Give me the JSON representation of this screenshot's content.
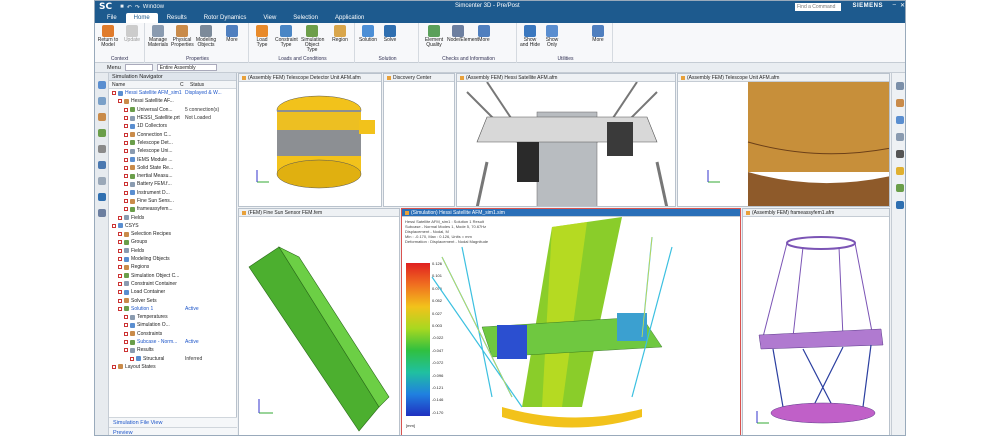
{
  "title": {
    "logo": "SC",
    "window_menu": "Window",
    "window_title": "Simcenter 3D - Pre/Post",
    "brand": "SIEMENS",
    "find_placeholder": "Find a Command"
  },
  "menus": [
    "File",
    "Home",
    "Results",
    "Rotor Dynamics",
    "View",
    "Selection",
    "Application"
  ],
  "ribbon": {
    "groups": [
      {
        "label": "Context",
        "buttons": [
          "Return to Model",
          "Update"
        ]
      },
      {
        "label": "Properties",
        "buttons": [
          "Manage Materials",
          "Physical Properties",
          "Modeling Objects",
          "More"
        ]
      },
      {
        "label": "Loads and Conditions",
        "buttons": [
          "Load Type",
          "Constraint Type",
          "Simulation Object Type",
          "Region"
        ]
      },
      {
        "label": "Solution",
        "buttons": [
          "Solution",
          "Solve"
        ]
      },
      {
        "label": "Checks and Information",
        "buttons": [
          "Element Quality",
          "Node/Element",
          "More"
        ]
      },
      {
        "label": "Utilities",
        "buttons": [
          "Show and Hide",
          "Show Only",
          "More"
        ]
      }
    ]
  },
  "cmdbar": {
    "menu": "Menu",
    "filter": "Entire Assembly"
  },
  "navigator": {
    "title": "Simulation Navigator",
    "columns": [
      "Name",
      "C",
      "Status"
    ],
    "rows": [
      {
        "name": "Hessi Satellite AFM_sim1",
        "status": "Displayed & W...",
        "blue": true,
        "indent": 0
      },
      {
        "name": "Hessi Satellite AF...",
        "status": "",
        "indent": 1
      },
      {
        "name": "Universal Con...",
        "status": "5 connection(s)",
        "indent": 2
      },
      {
        "name": "HESSI_Satellite.prt",
        "status": "Not Loaded",
        "indent": 2
      },
      {
        "name": "1D Collectors",
        "status": "",
        "indent": 2
      },
      {
        "name": "Connection C...",
        "status": "",
        "indent": 2
      },
      {
        "name": "Telescope Det...",
        "status": "",
        "indent": 2
      },
      {
        "name": "Telescope Uni...",
        "status": "",
        "indent": 2
      },
      {
        "name": "IEMS Module ...",
        "status": "",
        "indent": 2
      },
      {
        "name": "Solid State Re...",
        "status": "",
        "indent": 2
      },
      {
        "name": "Inertial Measu...",
        "status": "",
        "indent": 2
      },
      {
        "name": "Battery FEM.f...",
        "status": "",
        "indent": 2
      },
      {
        "name": "Instrument D...",
        "status": "",
        "indent": 2
      },
      {
        "name": "Fine Sun Sens...",
        "status": "",
        "indent": 2
      },
      {
        "name": "frameassyfem...",
        "status": "",
        "indent": 2
      },
      {
        "name": "Fields",
        "status": "",
        "indent": 1
      },
      {
        "name": "CSYS",
        "status": "",
        "indent": 0
      },
      {
        "name": "Selection Recipes",
        "status": "",
        "indent": 1
      },
      {
        "name": "Groups",
        "status": "",
        "indent": 1
      },
      {
        "name": "Fields",
        "status": "",
        "indent": 1
      },
      {
        "name": "Modeling Objects",
        "status": "",
        "indent": 1
      },
      {
        "name": "Regions",
        "status": "",
        "indent": 1
      },
      {
        "name": "Simulation Object C...",
        "status": "",
        "indent": 1
      },
      {
        "name": "Constraint Container",
        "status": "",
        "indent": 1
      },
      {
        "name": "Load Container",
        "status": "",
        "indent": 1
      },
      {
        "name": "Solver Sets",
        "status": "",
        "indent": 1
      },
      {
        "name": "Solution 1",
        "status": "Active",
        "blue": true,
        "indent": 1
      },
      {
        "name": "Temperatures",
        "status": "",
        "indent": 2
      },
      {
        "name": "Simulation O...",
        "status": "",
        "indent": 2
      },
      {
        "name": "Constraints",
        "status": "",
        "indent": 2
      },
      {
        "name": "Subcase - Norm...",
        "status": "Active",
        "blue": true,
        "indent": 2
      },
      {
        "name": "Results",
        "status": "",
        "indent": 2
      },
      {
        "name": "Structural",
        "status": "Inferred",
        "indent": 3
      },
      {
        "name": "Layout States",
        "status": "",
        "indent": 0
      }
    ],
    "footer": [
      "Simulation File View",
      "Preview"
    ]
  },
  "viewports": [
    {
      "tab": "(Assembly FEM) Telescope Detector Unit AFM.afm"
    },
    {
      "tab": "Discovery Center"
    },
    {
      "tab": "(Assembly FEM) Hessi Satellite AFM.afm"
    },
    {
      "tab": "(Assembly FEM) Telescope Unit AFM.afm"
    },
    {
      "tab": "(FEM) Fine Sun Sensor FEM.fem"
    },
    {
      "tab": "(Simulation) Hessi Satellite AFM_sim1.sim"
    },
    {
      "tab": "(Assembly FEM) frameassyfem1.afm"
    }
  ],
  "result_header": [
    "Hessi Satellite AFM_sim1 : Solution 1 Result",
    "Subcase - Normal Modes 1, Mode 5, 70.67Hz",
    "Displacement - Nodal, M",
    "Min : -0.170, Max : 0.126, Units = mm",
    "Deformation : Displacement - Nodal Magnitude"
  ],
  "legend": {
    "ticks": [
      "0.126",
      "0.101",
      "0.076",
      "0.052",
      "0.027",
      "0.003",
      "-0.022",
      "-0.047",
      "-0.072",
      "-0.096",
      "-0.121",
      "-0.146",
      "-0.170"
    ],
    "unit": "[mm]"
  },
  "colors": {
    "accent": "#1d5a8e",
    "active_tab": "#2a6fb8",
    "model_yellow": "#f2c21b",
    "model_green": "#4caf2f",
    "frame_purple": "#7b54b5"
  }
}
